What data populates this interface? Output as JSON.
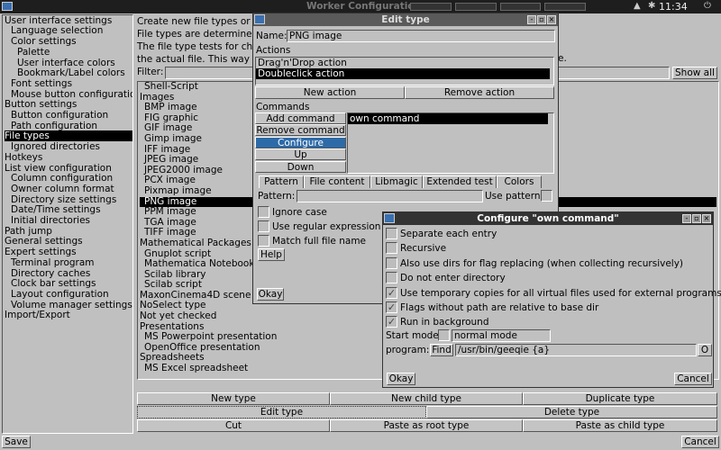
{
  "topbar": {
    "app_title": "Worker Configuration",
    "clock": "11:34"
  },
  "sidebar": {
    "items": [
      {
        "label": "User interface settings",
        "indent": 0
      },
      {
        "label": "Language selection",
        "indent": 1
      },
      {
        "label": "Color settings",
        "indent": 1
      },
      {
        "label": "Palette",
        "indent": 2
      },
      {
        "label": "User interface colors",
        "indent": 2
      },
      {
        "label": "Bookmark/Label colors",
        "indent": 2
      },
      {
        "label": "Font settings",
        "indent": 1
      },
      {
        "label": "Mouse button configuration",
        "indent": 1
      },
      {
        "label": "Button settings",
        "indent": 0
      },
      {
        "label": "Button configuration",
        "indent": 1
      },
      {
        "label": "Path configuration",
        "indent": 1
      },
      {
        "label": "File types",
        "indent": 0,
        "selected": true
      },
      {
        "label": "Ignored directories",
        "indent": 1
      },
      {
        "label": "Hotkeys",
        "indent": 0
      },
      {
        "label": "List view configuration",
        "indent": 0
      },
      {
        "label": "Column configuration",
        "indent": 1
      },
      {
        "label": "Owner column format",
        "indent": 1
      },
      {
        "label": "Directory size settings",
        "indent": 1
      },
      {
        "label": "Date/Time settings",
        "indent": 1
      },
      {
        "label": "Initial directories",
        "indent": 1
      },
      {
        "label": "Path jump",
        "indent": 0
      },
      {
        "label": "General settings",
        "indent": 0
      },
      {
        "label": "Expert settings",
        "indent": 0
      },
      {
        "label": "Terminal program",
        "indent": 1
      },
      {
        "label": "Directory caches",
        "indent": 1
      },
      {
        "label": "Clock bar settings",
        "indent": 1
      },
      {
        "label": "Layout configuration",
        "indent": 1
      },
      {
        "label": "Volume manager settings",
        "indent": 1
      },
      {
        "label": "Import/Export",
        "indent": 0
      }
    ]
  },
  "main": {
    "desc_lines": [
      "Create new file types or m",
      "File types are determined",
      "The file type tests for chil",
      "the actual file. This way c"
    ],
    "desc_tail": "e.",
    "filter_label": "Filter:",
    "show_all": "Show all",
    "filetypes": [
      {
        "label": "Shell-Script",
        "indent": 1
      },
      {
        "label": "Images",
        "indent": 0
      },
      {
        "label": "BMP image",
        "indent": 1
      },
      {
        "label": "FIG graphic",
        "indent": 1
      },
      {
        "label": "GIF image",
        "indent": 1
      },
      {
        "label": "Gimp image",
        "indent": 1
      },
      {
        "label": "IFF image",
        "indent": 1
      },
      {
        "label": "JPEG image",
        "indent": 1
      },
      {
        "label": "JPEG2000 image",
        "indent": 1
      },
      {
        "label": "PCX image",
        "indent": 1
      },
      {
        "label": "Pixmap image",
        "indent": 1
      },
      {
        "label": "PNG image",
        "indent": 1,
        "selected": true
      },
      {
        "label": "PPM image",
        "indent": 1
      },
      {
        "label": "TGA image",
        "indent": 1
      },
      {
        "label": "TIFF image",
        "indent": 1
      },
      {
        "label": "Mathematical Packages",
        "indent": 0
      },
      {
        "label": "Gnuplot script",
        "indent": 1
      },
      {
        "label": "Mathematica Notebook",
        "indent": 1
      },
      {
        "label": "Scilab library",
        "indent": 1
      },
      {
        "label": "Scilab script",
        "indent": 1
      },
      {
        "label": "MaxonCinema4D scene",
        "indent": 0
      },
      {
        "label": "NoSelect type",
        "indent": 0
      },
      {
        "label": "Not yet checked",
        "indent": 0
      },
      {
        "label": "Presentations",
        "indent": 0
      },
      {
        "label": "MS Powerpoint presentation",
        "indent": 1
      },
      {
        "label": "OpenOffice presentation",
        "indent": 1
      },
      {
        "label": "Spreadsheets",
        "indent": 0
      },
      {
        "label": "MS Excel spreadsheet",
        "indent": 1
      }
    ],
    "buttons": {
      "new_type": "New type",
      "new_child_type": "New child type",
      "duplicate_type": "Duplicate type",
      "edit_type": "Edit type",
      "delete_type": "Delete type",
      "cut": "Cut",
      "paste_root": "Paste as root type",
      "paste_child": "Paste as child type"
    },
    "save": "Save",
    "cancel": "Cancel"
  },
  "edit_type": {
    "title": "Edit type",
    "name_label": "Name:",
    "name_value": "PNG image",
    "actions_label": "Actions",
    "actions": [
      {
        "label": "Drag'n'Drop action"
      },
      {
        "label": "Doubleclick action",
        "selected": true
      }
    ],
    "new_action": "New action",
    "remove_action": "Remove action",
    "commands_label": "Commands",
    "cmd_buttons": [
      "Add command",
      "Remove command",
      "Configure",
      "Up",
      "Down"
    ],
    "command_item": "own command",
    "tabs": [
      "Pattern",
      "File content",
      "Libmagic",
      "Extended test",
      "Colors"
    ],
    "pattern_label": "Pattern:",
    "use_pattern": "Use pattern",
    "ignore_case": "Ignore case",
    "use_regex": "Use regular expression",
    "match_full": "Match full file name",
    "help": "Help",
    "okay": "Okay"
  },
  "configure": {
    "title": "Configure \"own command\"",
    "options": [
      {
        "label": "Separate each entry",
        "checked": false
      },
      {
        "label": "Recursive",
        "checked": false
      },
      {
        "label": "Also use dirs for flag replacing (when collecting recursively)",
        "checked": false
      },
      {
        "label": "Do not enter directory",
        "checked": false
      },
      {
        "label": "Use temporary copies for all virtual files used for external programs",
        "checked": true
      },
      {
        "label": "Flags without path are relative to base dir",
        "checked": true
      },
      {
        "label": "Run in background",
        "checked": true
      }
    ],
    "start_mode_label": "Start mode",
    "start_mode_value": "normal mode",
    "program_label": "program:",
    "find": "Find",
    "program_value": "/usr/bin/geeqie {a}",
    "o_button": "O",
    "okay": "Okay",
    "cancel": "Cancel"
  },
  "colors": {
    "selection": "#000000",
    "highlight": "#2d6aa8",
    "background": "#bfbfbf",
    "titlebar": "#333333"
  }
}
